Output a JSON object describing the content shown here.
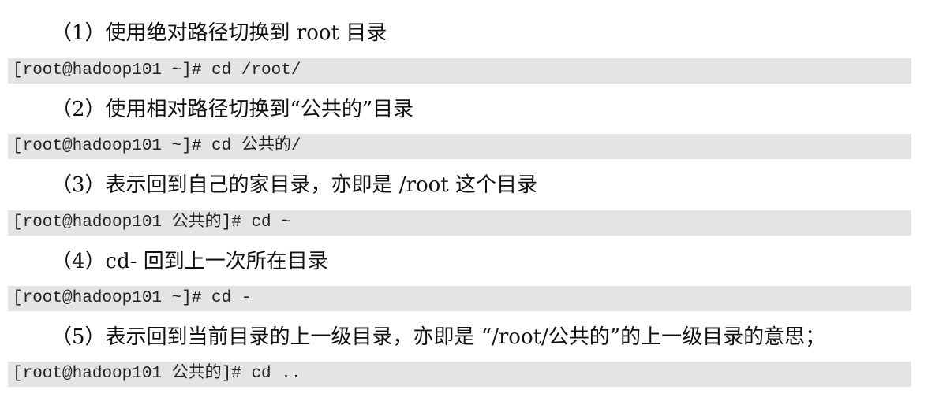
{
  "steps": [
    {
      "text": "（1）使用绝对路径切换到 root 目录",
      "command": "[root@hadoop101 ~]# cd /root/"
    },
    {
      "text": "（2）使用相对路径切换到“公共的”目录",
      "command": "[root@hadoop101 ~]# cd 公共的/"
    },
    {
      "text": "（3）表示回到自己的家目录，亦即是 /root 这个目录",
      "command": "[root@hadoop101 公共的]# cd ~"
    },
    {
      "text": "（4）cd- 回到上一次所在目录",
      "command": "[root@hadoop101 ~]# cd -"
    },
    {
      "text": "（5）表示回到当前目录的上一级目录，亦即是 “/root/公共的”的上一级目录的意思；",
      "command": "[root@hadoop101 公共的]# cd .."
    }
  ]
}
